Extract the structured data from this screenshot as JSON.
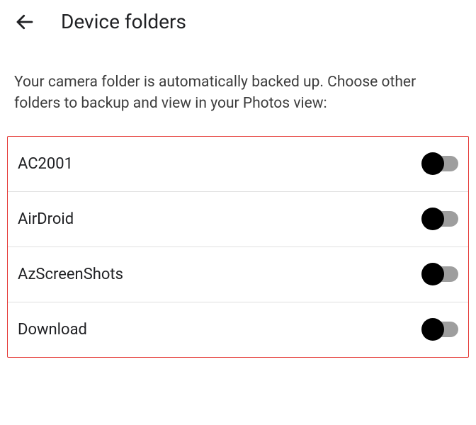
{
  "header": {
    "title": "Device folders"
  },
  "description": "Your camera folder is automatically backed up. Choose other folders to backup and view in your Photos view:",
  "folders": [
    {
      "name": "AC2001",
      "enabled": false
    },
    {
      "name": "AirDroid",
      "enabled": false
    },
    {
      "name": "AzScreenShots",
      "enabled": false
    },
    {
      "name": "Download",
      "enabled": false
    }
  ]
}
